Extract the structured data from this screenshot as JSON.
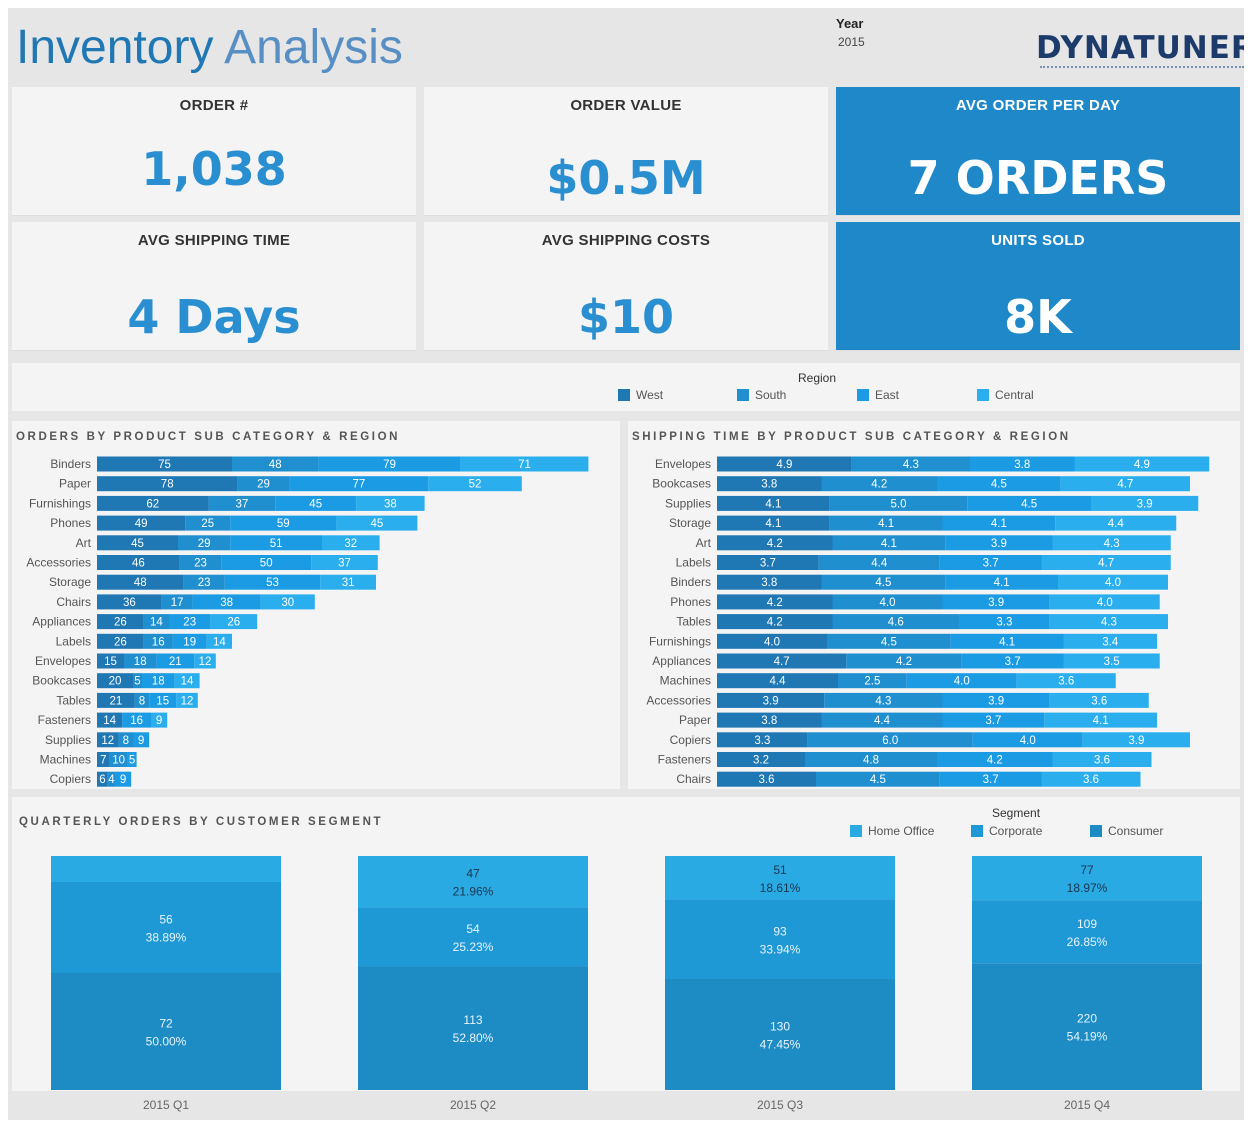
{
  "header": {
    "title_word1": "Inventory",
    "title_word2": "Analysis",
    "year_label": "Year",
    "year_value": "2015",
    "logo_text": "DYNATUNER"
  },
  "kpis": [
    {
      "label": "ORDER #",
      "value": "1,038"
    },
    {
      "label": "ORDER VALUE",
      "value": "$0.5M"
    },
    {
      "label": "AVG ORDER PER DAY",
      "value": "7 ORDERS"
    },
    {
      "label": "AVG SHIPPING TIME",
      "value": "4 Days"
    },
    {
      "label": "AVG SHIPPING COSTS",
      "value": "$10"
    },
    {
      "label": "UNITS SOLD",
      "value": "8K"
    }
  ],
  "colors": {
    "west": "#1f77b4",
    "south": "#1f8fd0",
    "east": "#1a9be4",
    "central": "#2aaeee",
    "home_office": "#29aae3",
    "corporate": "#1f98d6",
    "consumer": "#1e8cc4",
    "kpi_accent": "#1f88c8"
  },
  "region_legend": {
    "title": "Region",
    "items": [
      "West",
      "South",
      "East",
      "Central"
    ]
  },
  "segment_legend": {
    "title": "Segment",
    "items": [
      "Home Office",
      "Corporate",
      "Consumer"
    ]
  },
  "chart_data": [
    {
      "type": "bar",
      "orientation": "horizontal",
      "stacked": true,
      "title": "ORDERS BY PRODUCT SUB CATEGORY & REGION",
      "categories": [
        "Binders",
        "Paper",
        "Furnishings",
        "Phones",
        "Art",
        "Accessories",
        "Storage",
        "Chairs",
        "Appliances",
        "Labels",
        "Envelopes",
        "Bookcases",
        "Tables",
        "Fasteners",
        "Supplies",
        "Machines",
        "Copiers"
      ],
      "series": [
        {
          "name": "West",
          "values": [
            75,
            78,
            62,
            49,
            45,
            46,
            48,
            36,
            26,
            26,
            15,
            20,
            21,
            14,
            12,
            7,
            6
          ]
        },
        {
          "name": "South",
          "values": [
            48,
            29,
            37,
            25,
            29,
            23,
            23,
            17,
            14,
            16,
            18,
            5,
            8,
            null,
            8,
            10,
            4
          ]
        },
        {
          "name": "East",
          "values": [
            79,
            77,
            45,
            59,
            51,
            50,
            53,
            38,
            23,
            19,
            21,
            18,
            15,
            16,
            9,
            5,
            9
          ]
        },
        {
          "name": "Central",
          "values": [
            71,
            52,
            38,
            45,
            32,
            37,
            31,
            30,
            26,
            14,
            12,
            14,
            12,
            9,
            null,
            null,
            null
          ]
        }
      ]
    },
    {
      "type": "bar",
      "orientation": "horizontal",
      "stacked": true,
      "title": "SHIPPING TIME BY PRODUCT SUB CATEGORY & REGION",
      "categories": [
        "Envelopes",
        "Bookcases",
        "Supplies",
        "Storage",
        "Art",
        "Labels",
        "Binders",
        "Phones",
        "Tables",
        "Furnishings",
        "Appliances",
        "Machines",
        "Accessories",
        "Paper",
        "Copiers",
        "Fasteners",
        "Chairs"
      ],
      "series": [
        {
          "name": "West",
          "values": [
            4.9,
            3.8,
            4.1,
            4.1,
            4.2,
            3.7,
            3.8,
            4.2,
            4.2,
            4.0,
            4.7,
            4.4,
            3.9,
            3.8,
            3.3,
            3.2,
            3.6
          ]
        },
        {
          "name": "South",
          "values": [
            4.3,
            4.2,
            5.0,
            4.1,
            4.1,
            4.4,
            4.5,
            4.0,
            4.6,
            4.5,
            4.2,
            2.5,
            4.3,
            4.4,
            6.0,
            4.8,
            4.5
          ]
        },
        {
          "name": "East",
          "values": [
            3.8,
            4.5,
            4.5,
            4.1,
            3.9,
            3.7,
            4.1,
            3.9,
            3.3,
            4.1,
            3.7,
            4.0,
            3.9,
            3.7,
            4.0,
            4.2,
            3.7
          ]
        },
        {
          "name": "Central",
          "values": [
            4.9,
            4.7,
            3.9,
            4.4,
            4.3,
            4.7,
            4.0,
            4.0,
            4.3,
            3.4,
            3.5,
            3.6,
            3.6,
            4.1,
            3.9,
            3.6,
            3.6
          ]
        }
      ]
    },
    {
      "type": "bar",
      "orientation": "vertical",
      "stacked": "percent",
      "title": "QUARTERLY ORDERS BY CUSTOMER SEGMENT",
      "categories": [
        "2015 Q1",
        "2015 Q2",
        "2015 Q3",
        "2015 Q4"
      ],
      "series": [
        {
          "name": "Home Office",
          "values": [
            16,
            47,
            51,
            77
          ],
          "labels": [
            "",
            "47",
            "51",
            "77"
          ],
          "pcts": [
            "",
            "21.96%",
            "18.61%",
            "18.97%"
          ]
        },
        {
          "name": "Corporate",
          "values": [
            56,
            54,
            93,
            109
          ],
          "labels": [
            "56",
            "54",
            "93",
            "109"
          ],
          "pcts": [
            "38.89%",
            "25.23%",
            "33.94%",
            "26.85%"
          ]
        },
        {
          "name": "Consumer",
          "values": [
            72,
            113,
            130,
            220
          ],
          "labels": [
            "72",
            "113",
            "130",
            "220"
          ],
          "pcts": [
            "50.00%",
            "52.80%",
            "47.45%",
            "54.19%"
          ]
        }
      ]
    }
  ]
}
